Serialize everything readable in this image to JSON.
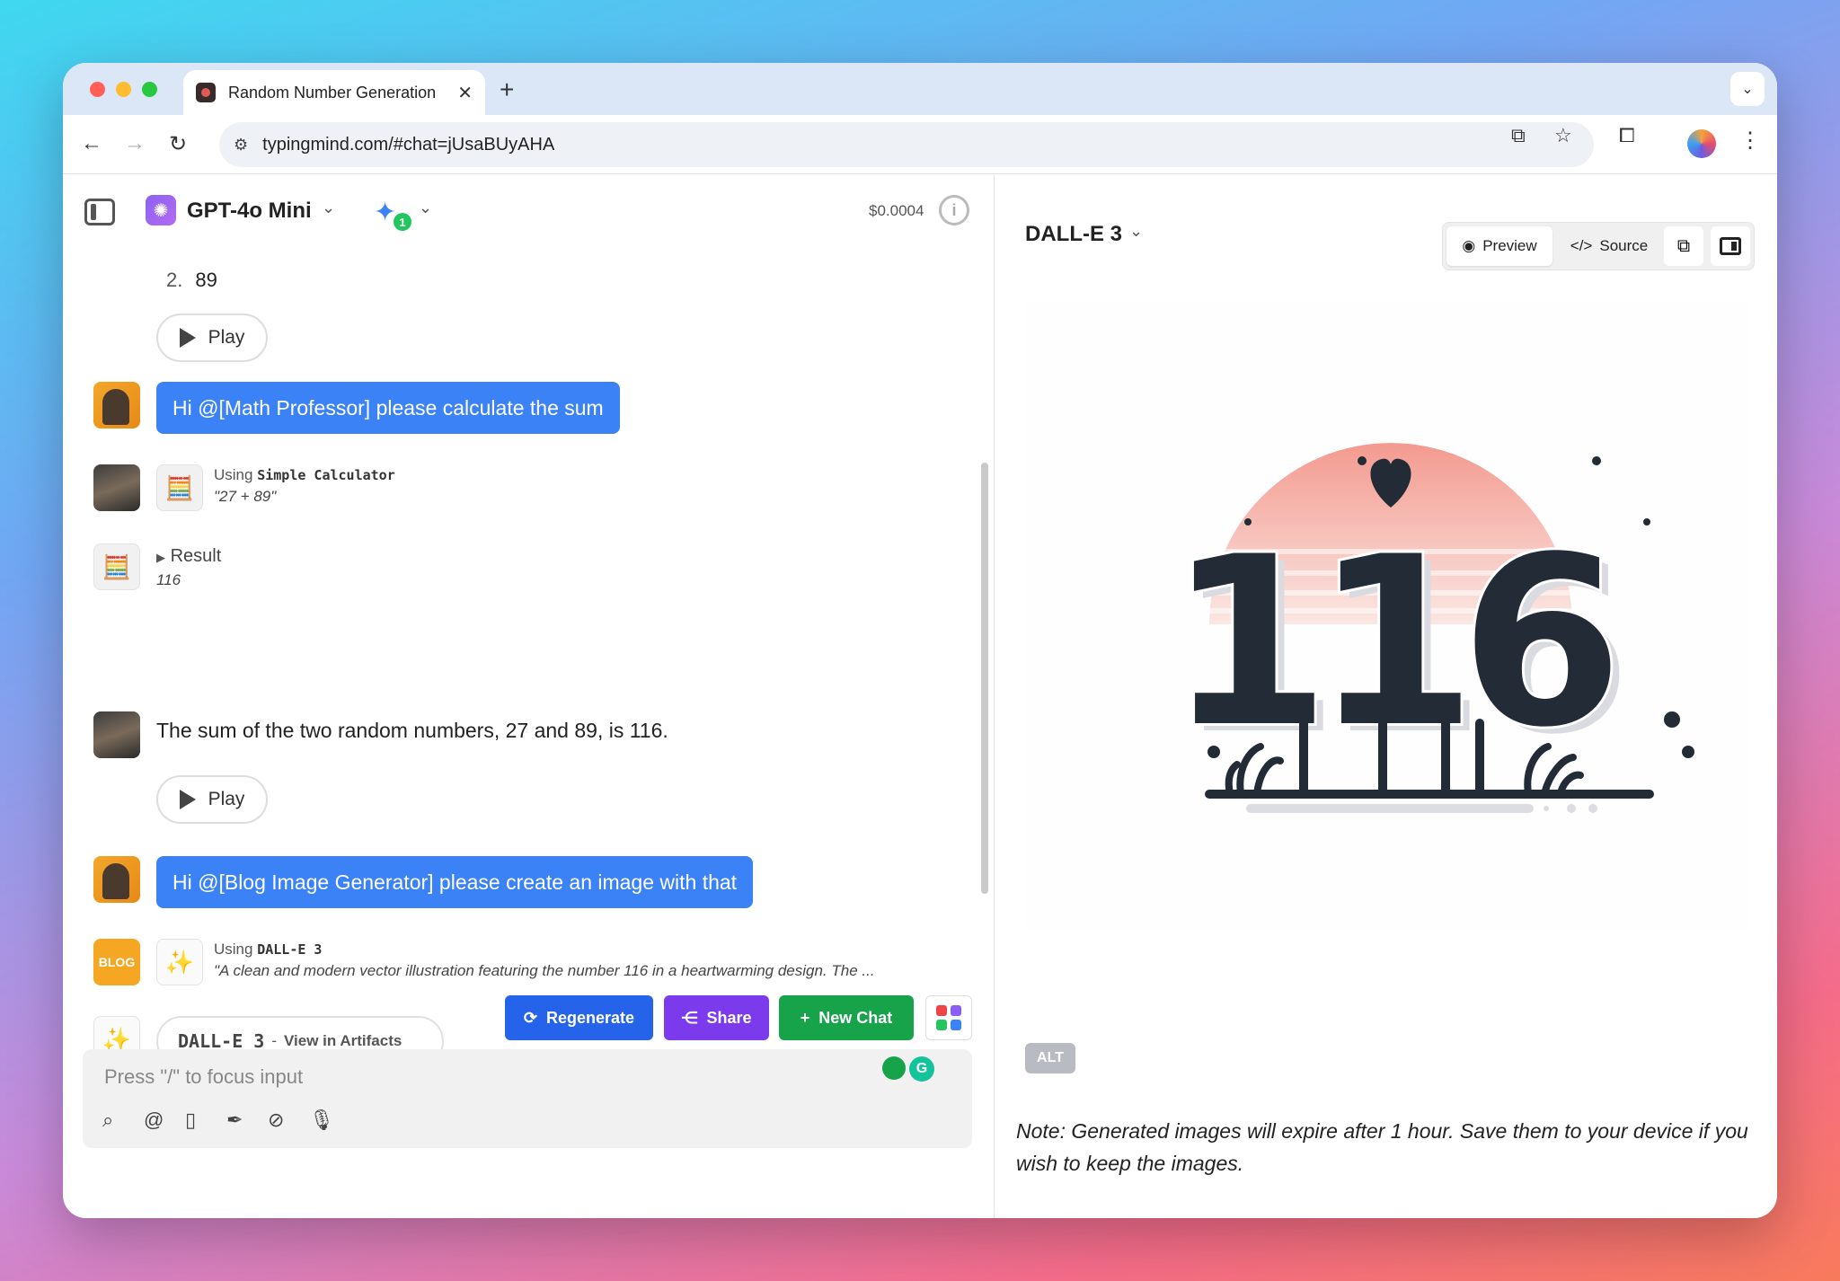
{
  "browser": {
    "tab_title": "Random Number Generation",
    "tab_close": "✕",
    "new_tab": "+",
    "url": "typingmind.com/#chat=jUsaBUyAHA"
  },
  "chat_header": {
    "model": "GPT-4o Mini",
    "plugin_count": "1",
    "cost": "$0.0004"
  },
  "messages": {
    "list_number": "2.",
    "list_value": "89",
    "play_label": "Play",
    "user_msg_1": "Hi @[Math Professor] please calculate the sum",
    "tool_using_prefix": "Using",
    "tool_name_1": "Simple Calculator",
    "tool_args_1": "\"27 + 89\"",
    "result_label": "Result",
    "result_value": "116",
    "answer_text": "The sum of the two random numbers, 27 and 89, is 116.",
    "user_msg_2": "Hi @[Blog Image Generator] please create an image with that",
    "tool_name_2": "DALL-E 3",
    "tool_args_2": "\"A clean and modern vector illustration featuring the number 116 in a heartwarming design. The ...",
    "artifact_name": "DALL-E 3",
    "artifact_sep": "-",
    "artifact_link": "View in Artifacts",
    "blog_badge": "BLOG"
  },
  "actions": {
    "regenerate": "Regenerate",
    "share": "Share",
    "new_chat": "New Chat"
  },
  "input": {
    "placeholder": "Press \"/\" to focus input"
  },
  "artifact": {
    "title": "DALL-E 3",
    "preview_label": "Preview",
    "source_label": "Source",
    "image_number": "116",
    "alt_label": "ALT",
    "note": "Note: Generated images will expire after 1 hour. Save them to your device if you wish to keep the images."
  },
  "colors": {
    "primary_blue": "#3b82f6",
    "regenerate": "#2563eb",
    "share": "#7c3aed",
    "new_chat": "#16a34a"
  }
}
